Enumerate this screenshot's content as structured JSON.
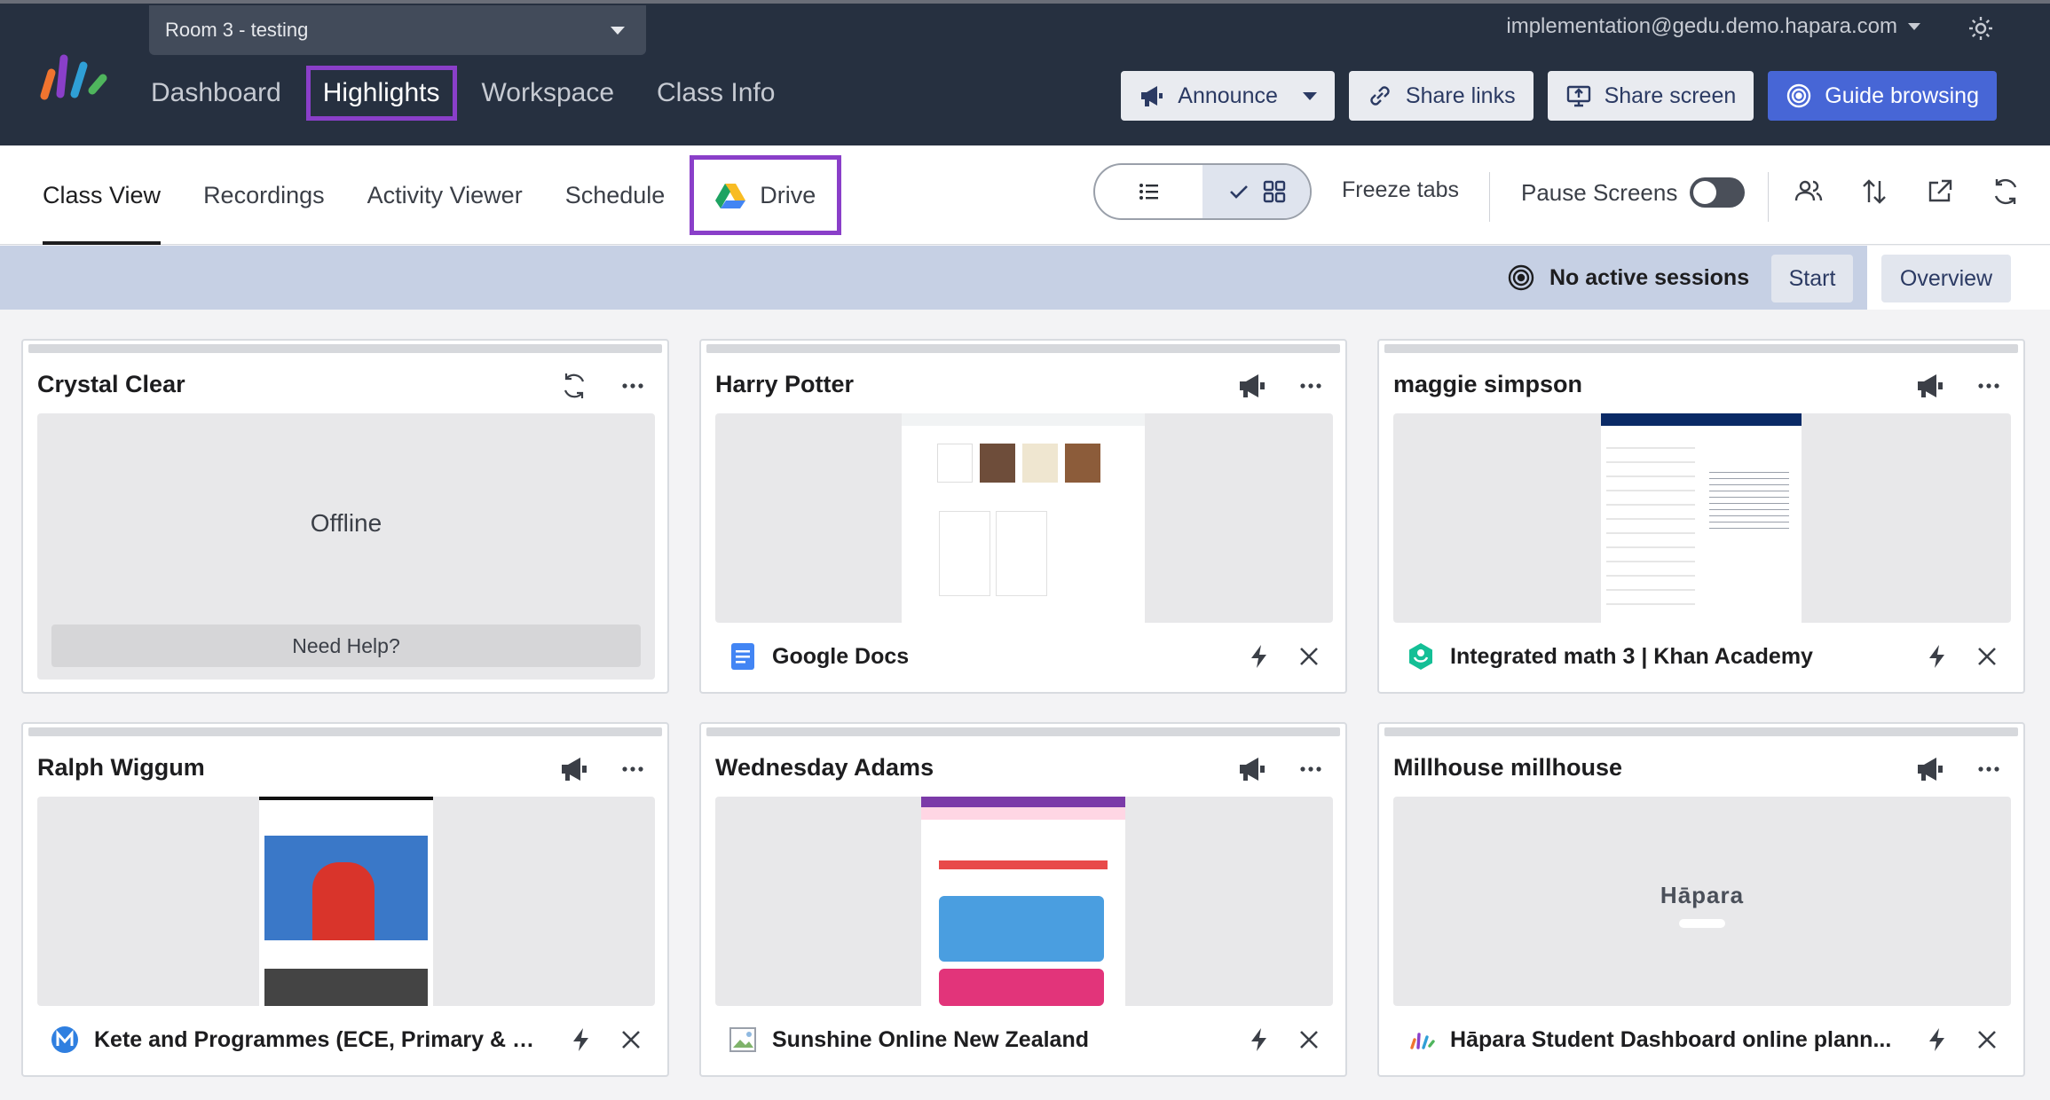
{
  "room_select": {
    "label": "Room 3 - testing"
  },
  "main_nav": [
    {
      "label": "Dashboard",
      "active": false
    },
    {
      "label": "Highlights",
      "active": true
    },
    {
      "label": "Workspace",
      "active": false
    },
    {
      "label": "Class Info",
      "active": false
    }
  ],
  "account": {
    "email": "implementation@gedu.demo.hapara.com"
  },
  "top_actions": {
    "announce": "Announce",
    "share_links": "Share links",
    "share_screen": "Share screen",
    "guide_browsing": "Guide browsing"
  },
  "sub_tabs": [
    {
      "label": "Class View",
      "active": true
    },
    {
      "label": "Recordings",
      "active": false
    },
    {
      "label": "Activity Viewer",
      "active": false
    },
    {
      "label": "Schedule",
      "active": false
    },
    {
      "label": "Drive",
      "active": false
    }
  ],
  "toolbar": {
    "freeze_tabs": "Freeze tabs",
    "pause_screens": "Pause Screens",
    "pause_screens_on": false
  },
  "session": {
    "status": "No active sessions",
    "start": "Start",
    "overview": "Overview"
  },
  "students": [
    {
      "name": "Crystal Clear",
      "status": "Offline",
      "help": "Need Help?"
    },
    {
      "name": "Harry Potter",
      "site": "Google Docs"
    },
    {
      "name": "maggie simpson",
      "site": "Integrated math 3 | Khan Academy"
    },
    {
      "name": "Ralph Wiggum",
      "site": "Kete and Programmes (ECE, Primary & Se..."
    },
    {
      "name": "Wednesday Adams",
      "site": "Sunshine Online New Zealand"
    },
    {
      "name": "Millhouse millhouse",
      "site": "Hāpara Student Dashboard online plann...",
      "preview_logo": "Hāpara"
    }
  ],
  "colors": {
    "topbar": "#263040",
    "highlight_border": "#8a3fc9",
    "primary_button": "#4766d6",
    "session_bar": "#c6d0e4"
  },
  "icons": [
    "hapara-logo",
    "gear-icon",
    "megaphone-icon",
    "link-icon",
    "screen-share-icon",
    "target-icon",
    "google-drive-icon",
    "list-icon",
    "grid-icon",
    "users-icon",
    "sort-icon",
    "open-external-icon",
    "refresh-icon",
    "more-icon",
    "lightning-icon",
    "close-icon"
  ]
}
